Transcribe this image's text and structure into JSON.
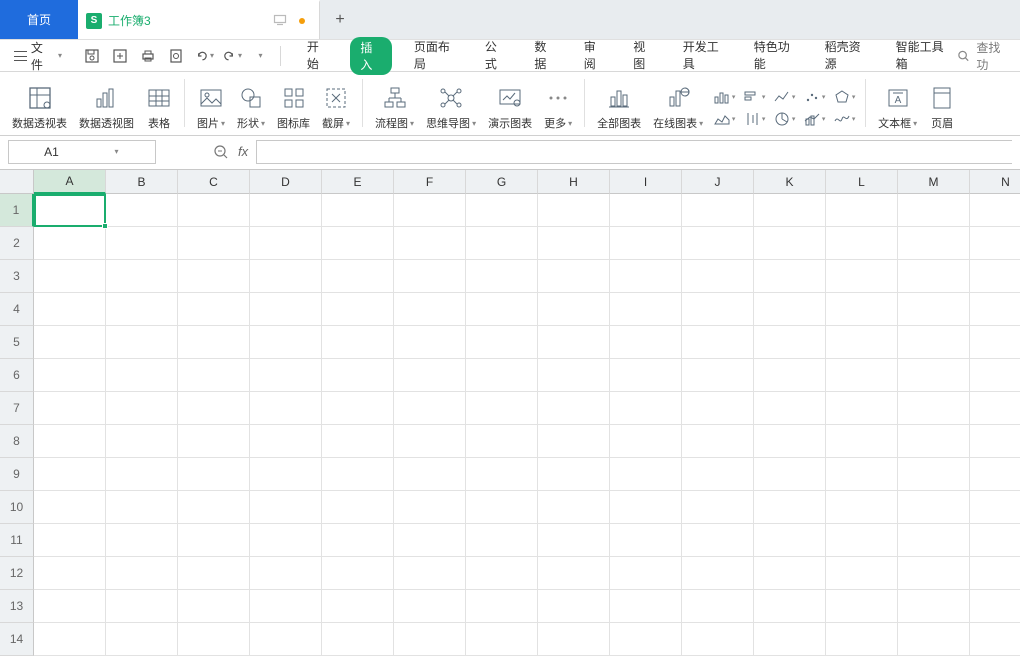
{
  "titlebar": {
    "home": "首页",
    "doc_name": "工作簿3",
    "doc_icon_letter": "S",
    "new_tab": "+"
  },
  "file_menu": {
    "label": "文件"
  },
  "ribbon_tabs": {
    "start": "开始",
    "insert": "插入",
    "page_layout": "页面布局",
    "formula": "公式",
    "data": "数据",
    "review": "审阅",
    "view": "视图",
    "dev": "开发工具",
    "special": "特色功能",
    "resource": "稻壳资源",
    "toolbox": "智能工具箱"
  },
  "search": {
    "label": "查找功"
  },
  "ribbon": {
    "pivot_table": "数据透视表",
    "pivot_chart": "数据透视图",
    "table": "表格",
    "picture": "图片",
    "shape": "形状",
    "icons": "图标库",
    "screenshot": "截屏",
    "flowchart": "流程图",
    "mindmap": "思维导图",
    "demo_chart": "演示图表",
    "more": "更多",
    "all_charts": "全部图表",
    "online_chart": "在线图表",
    "textbox": "文本框",
    "header_footer": "页眉"
  },
  "namebox": {
    "value": "A1"
  },
  "fx_label": "fx",
  "columns": [
    "A",
    "B",
    "C",
    "D",
    "E",
    "F",
    "G",
    "H",
    "I",
    "J",
    "K",
    "L",
    "M",
    "N"
  ],
  "rows": [
    "1",
    "2",
    "3",
    "4",
    "5",
    "6",
    "7",
    "8",
    "9",
    "10",
    "11",
    "12",
    "13",
    "14"
  ],
  "selected": {
    "col": 0,
    "row": 0
  },
  "colors": {
    "accent": "#1aad6e",
    "home_tab": "#1f6cdd"
  }
}
